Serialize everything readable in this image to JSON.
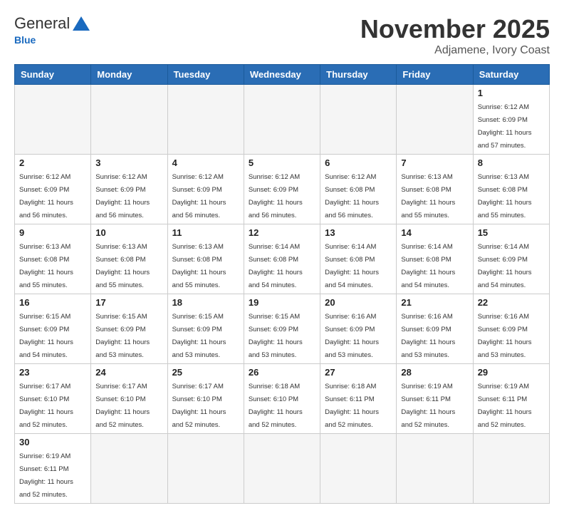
{
  "header": {
    "logo_general": "General",
    "logo_blue": "Blue",
    "month": "November 2025",
    "location": "Adjamene, Ivory Coast"
  },
  "weekdays": [
    "Sunday",
    "Monday",
    "Tuesday",
    "Wednesday",
    "Thursday",
    "Friday",
    "Saturday"
  ],
  "days": {
    "1": {
      "sunrise": "Sunrise: 6:12 AM",
      "sunset": "Sunset: 6:09 PM",
      "daylight": "Daylight: 11 hours and 57 minutes."
    },
    "2": {
      "sunrise": "Sunrise: 6:12 AM",
      "sunset": "Sunset: 6:09 PM",
      "daylight": "Daylight: 11 hours and 56 minutes."
    },
    "3": {
      "sunrise": "Sunrise: 6:12 AM",
      "sunset": "Sunset: 6:09 PM",
      "daylight": "Daylight: 11 hours and 56 minutes."
    },
    "4": {
      "sunrise": "Sunrise: 6:12 AM",
      "sunset": "Sunset: 6:09 PM",
      "daylight": "Daylight: 11 hours and 56 minutes."
    },
    "5": {
      "sunrise": "Sunrise: 6:12 AM",
      "sunset": "Sunset: 6:09 PM",
      "daylight": "Daylight: 11 hours and 56 minutes."
    },
    "6": {
      "sunrise": "Sunrise: 6:12 AM",
      "sunset": "Sunset: 6:08 PM",
      "daylight": "Daylight: 11 hours and 56 minutes."
    },
    "7": {
      "sunrise": "Sunrise: 6:13 AM",
      "sunset": "Sunset: 6:08 PM",
      "daylight": "Daylight: 11 hours and 55 minutes."
    },
    "8": {
      "sunrise": "Sunrise: 6:13 AM",
      "sunset": "Sunset: 6:08 PM",
      "daylight": "Daylight: 11 hours and 55 minutes."
    },
    "9": {
      "sunrise": "Sunrise: 6:13 AM",
      "sunset": "Sunset: 6:08 PM",
      "daylight": "Daylight: 11 hours and 55 minutes."
    },
    "10": {
      "sunrise": "Sunrise: 6:13 AM",
      "sunset": "Sunset: 6:08 PM",
      "daylight": "Daylight: 11 hours and 55 minutes."
    },
    "11": {
      "sunrise": "Sunrise: 6:13 AM",
      "sunset": "Sunset: 6:08 PM",
      "daylight": "Daylight: 11 hours and 55 minutes."
    },
    "12": {
      "sunrise": "Sunrise: 6:14 AM",
      "sunset": "Sunset: 6:08 PM",
      "daylight": "Daylight: 11 hours and 54 minutes."
    },
    "13": {
      "sunrise": "Sunrise: 6:14 AM",
      "sunset": "Sunset: 6:08 PM",
      "daylight": "Daylight: 11 hours and 54 minutes."
    },
    "14": {
      "sunrise": "Sunrise: 6:14 AM",
      "sunset": "Sunset: 6:08 PM",
      "daylight": "Daylight: 11 hours and 54 minutes."
    },
    "15": {
      "sunrise": "Sunrise: 6:14 AM",
      "sunset": "Sunset: 6:09 PM",
      "daylight": "Daylight: 11 hours and 54 minutes."
    },
    "16": {
      "sunrise": "Sunrise: 6:15 AM",
      "sunset": "Sunset: 6:09 PM",
      "daylight": "Daylight: 11 hours and 54 minutes."
    },
    "17": {
      "sunrise": "Sunrise: 6:15 AM",
      "sunset": "Sunset: 6:09 PM",
      "daylight": "Daylight: 11 hours and 53 minutes."
    },
    "18": {
      "sunrise": "Sunrise: 6:15 AM",
      "sunset": "Sunset: 6:09 PM",
      "daylight": "Daylight: 11 hours and 53 minutes."
    },
    "19": {
      "sunrise": "Sunrise: 6:15 AM",
      "sunset": "Sunset: 6:09 PM",
      "daylight": "Daylight: 11 hours and 53 minutes."
    },
    "20": {
      "sunrise": "Sunrise: 6:16 AM",
      "sunset": "Sunset: 6:09 PM",
      "daylight": "Daylight: 11 hours and 53 minutes."
    },
    "21": {
      "sunrise": "Sunrise: 6:16 AM",
      "sunset": "Sunset: 6:09 PM",
      "daylight": "Daylight: 11 hours and 53 minutes."
    },
    "22": {
      "sunrise": "Sunrise: 6:16 AM",
      "sunset": "Sunset: 6:09 PM",
      "daylight": "Daylight: 11 hours and 53 minutes."
    },
    "23": {
      "sunrise": "Sunrise: 6:17 AM",
      "sunset": "Sunset: 6:10 PM",
      "daylight": "Daylight: 11 hours and 52 minutes."
    },
    "24": {
      "sunrise": "Sunrise: 6:17 AM",
      "sunset": "Sunset: 6:10 PM",
      "daylight": "Daylight: 11 hours and 52 minutes."
    },
    "25": {
      "sunrise": "Sunrise: 6:17 AM",
      "sunset": "Sunset: 6:10 PM",
      "daylight": "Daylight: 11 hours and 52 minutes."
    },
    "26": {
      "sunrise": "Sunrise: 6:18 AM",
      "sunset": "Sunset: 6:10 PM",
      "daylight": "Daylight: 11 hours and 52 minutes."
    },
    "27": {
      "sunrise": "Sunrise: 6:18 AM",
      "sunset": "Sunset: 6:11 PM",
      "daylight": "Daylight: 11 hours and 52 minutes."
    },
    "28": {
      "sunrise": "Sunrise: 6:19 AM",
      "sunset": "Sunset: 6:11 PM",
      "daylight": "Daylight: 11 hours and 52 minutes."
    },
    "29": {
      "sunrise": "Sunrise: 6:19 AM",
      "sunset": "Sunset: 6:11 PM",
      "daylight": "Daylight: 11 hours and 52 minutes."
    },
    "30": {
      "sunrise": "Sunrise: 6:19 AM",
      "sunset": "Sunset: 6:11 PM",
      "daylight": "Daylight: 11 hours and 52 minutes."
    }
  }
}
